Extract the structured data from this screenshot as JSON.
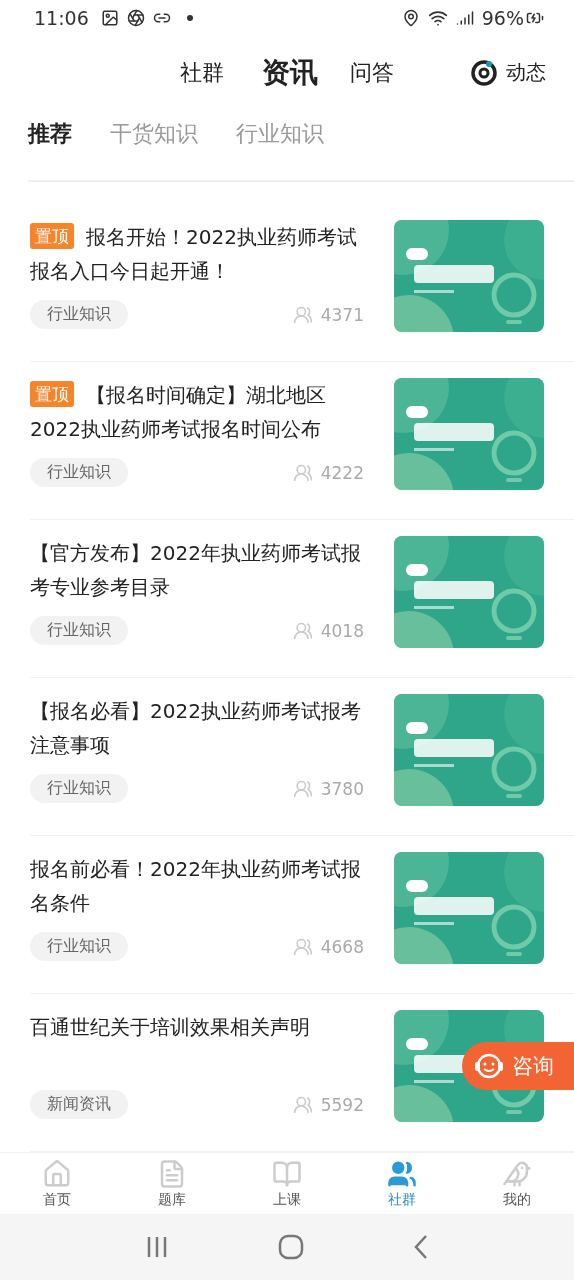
{
  "status_bar": {
    "time": "11:06",
    "battery": "96%"
  },
  "top_tabs": [
    {
      "label": "社群",
      "selected": false
    },
    {
      "label": "资讯",
      "selected": true
    },
    {
      "label": "问答",
      "selected": false
    }
  ],
  "dynamic_button": {
    "label": "动态"
  },
  "sub_tabs": [
    {
      "label": "推荐",
      "selected": true
    },
    {
      "label": "干货知识",
      "selected": false
    },
    {
      "label": "行业知识",
      "selected": false
    }
  ],
  "articles": [
    {
      "pinned": true,
      "pin_label": "置顶",
      "title": "报名开始！2022执业药师考试报名入口今日起开通！",
      "tag": "行业知识",
      "views": "4371"
    },
    {
      "pinned": true,
      "pin_label": "置顶",
      "title": "【报名时间确定】湖北地区2022执业药师考试报名时间公布",
      "tag": "行业知识",
      "views": "4222"
    },
    {
      "pinned": false,
      "title": "【官方发布】2022年执业药师考试报考专业参考目录",
      "tag": "行业知识",
      "views": "4018"
    },
    {
      "pinned": false,
      "title": "【报名必看】2022执业药师考试报考注意事项",
      "tag": "行业知识",
      "views": "3780"
    },
    {
      "pinned": false,
      "title": "报名前必看！2022年执业药师考试报名条件",
      "tag": "行业知识",
      "views": "4668"
    },
    {
      "pinned": false,
      "title": "百通世纪关于培训效果相关声明",
      "tag": "新闻资讯",
      "views": "5592"
    }
  ],
  "consult_button": {
    "label": "咨询"
  },
  "bottom_nav": [
    {
      "kind": "home",
      "label": "首页",
      "selected": false
    },
    {
      "kind": "bank",
      "label": "题库",
      "selected": false
    },
    {
      "kind": "class",
      "label": "上课",
      "selected": false
    },
    {
      "kind": "community",
      "label": "社群",
      "selected": true
    },
    {
      "kind": "me",
      "label": "我的",
      "selected": false
    }
  ]
}
